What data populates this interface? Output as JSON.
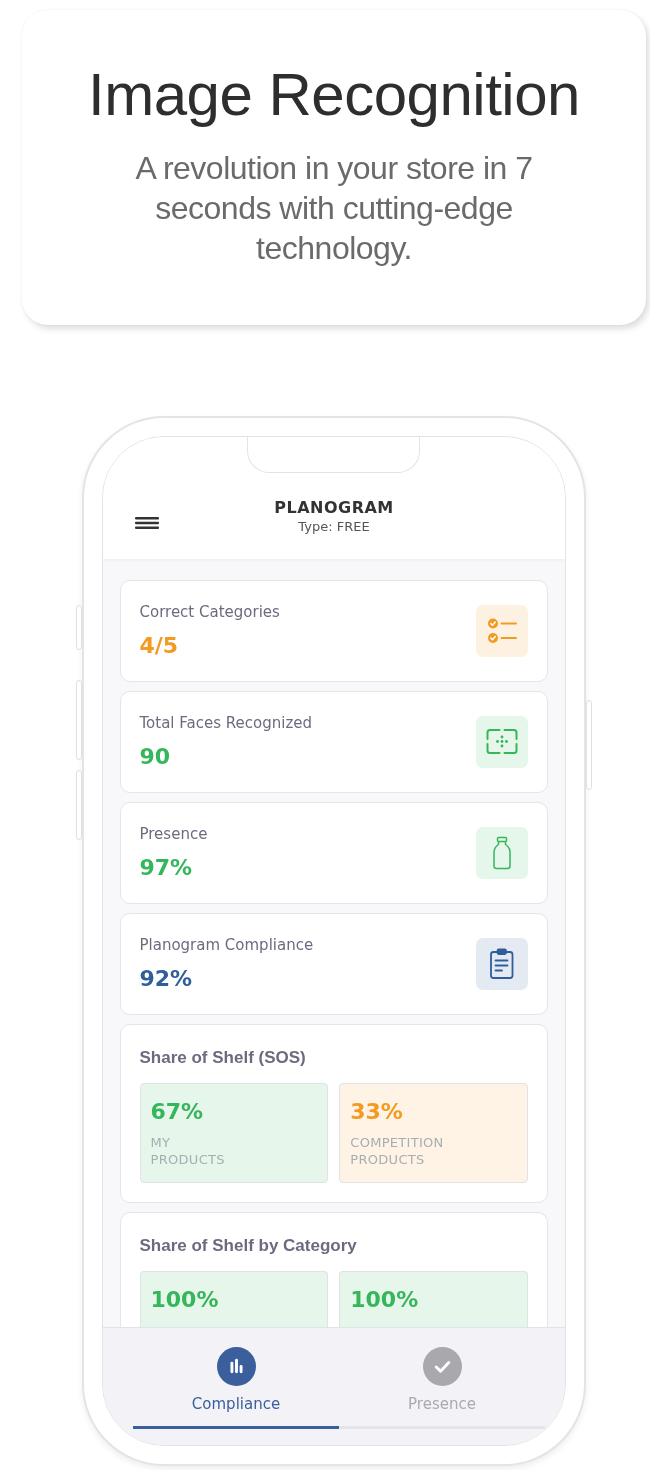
{
  "hero": {
    "title": "Image Recognition",
    "subtitle": "A revolution in your store in 7 seconds with cutting-edge technology."
  },
  "app_header": {
    "title": "PLANOGRAM",
    "subtitle": "Type: FREE"
  },
  "metrics": [
    {
      "kind": "checklist",
      "label": "Correct Categories",
      "value": "4/5",
      "color": "#f39a22"
    },
    {
      "kind": "scan",
      "label": "Total Faces Recognized",
      "value": "90",
      "color": "#36b65a"
    },
    {
      "kind": "bottle",
      "label": "Presence",
      "value": "97%",
      "color": "#36b65a"
    },
    {
      "kind": "clipboard",
      "label": "Planogram Compliance",
      "value": "92%",
      "color": "#2f5e9b"
    }
  ],
  "share_sections": [
    {
      "title": "Share of Shelf (SOS)",
      "tiles": [
        {
          "value": "67%",
          "label": "MY PRODUCTS",
          "color": "#36b65a"
        },
        {
          "value": "33%",
          "label": "COMPETITION PRODUCTS",
          "color": "#f39a22"
        }
      ]
    },
    {
      "title": "Share of Shelf by Category",
      "tiles": [
        {
          "value": "100%",
          "color": "#36b65a"
        },
        {
          "value": "100%",
          "color": "#36b65a"
        }
      ]
    }
  ],
  "bottom_nav": [
    {
      "kind": "chart",
      "label": "Compliance",
      "selected": true
    },
    {
      "kind": "check",
      "label": "Presence",
      "selected": false
    }
  ]
}
